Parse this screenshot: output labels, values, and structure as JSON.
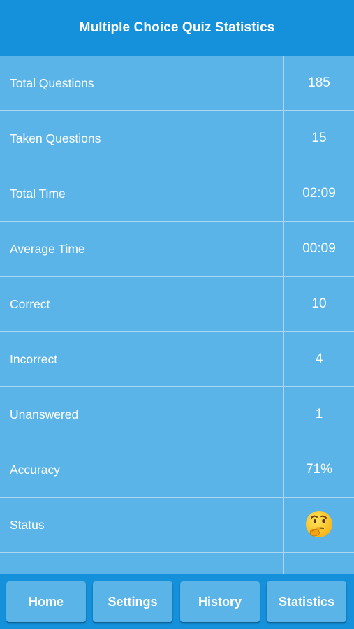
{
  "header": {
    "title": "Multiple Choice Quiz Statistics"
  },
  "stats": [
    {
      "label": "Total Questions",
      "value": "185"
    },
    {
      "label": "Taken Questions",
      "value": "15"
    },
    {
      "label": "Total Time",
      "value": "02:09"
    },
    {
      "label": "Average Time",
      "value": "00:09"
    },
    {
      "label": "Correct",
      "value": "10"
    },
    {
      "label": "Incorrect",
      "value": "4"
    },
    {
      "label": "Unanswered",
      "value": "1"
    },
    {
      "label": "Accuracy",
      "value": "71%"
    },
    {
      "label": "Status",
      "icon": "thinking-face-icon"
    }
  ],
  "tabs": [
    {
      "label": "Home"
    },
    {
      "label": "Settings"
    },
    {
      "label": "History"
    },
    {
      "label": "Statistics"
    }
  ],
  "colors": {
    "header_bg": "#1591dc",
    "table_bg": "#5ab4e8",
    "divider": "#a9d6f3",
    "text": "#ffffff"
  }
}
